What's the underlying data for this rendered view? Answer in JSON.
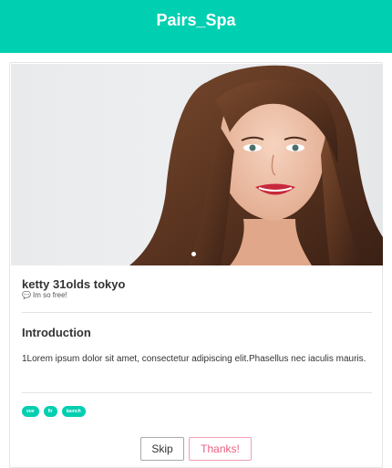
{
  "header": {
    "title": "Pairs_Spa"
  },
  "profile": {
    "photo": {
      "description_icon": "profile-photo",
      "slide_count_visible": 1
    },
    "name_line": "ketty 31olds tokyo",
    "status_icon": "speech-bubble-icon",
    "status": "Im so free!"
  },
  "introduction": {
    "title": "Introduction",
    "text": "1Lorem ipsum dolor sit amet, consectetur adipiscing elit.Phasellus nec iaculis mauris."
  },
  "tags": [
    "vue",
    "fir",
    "launch"
  ],
  "actions": {
    "skip_label": "Skip",
    "thanks_label": "Thanks!"
  },
  "colors": {
    "accent": "#00cfb1",
    "thanks": "#e8617f"
  }
}
